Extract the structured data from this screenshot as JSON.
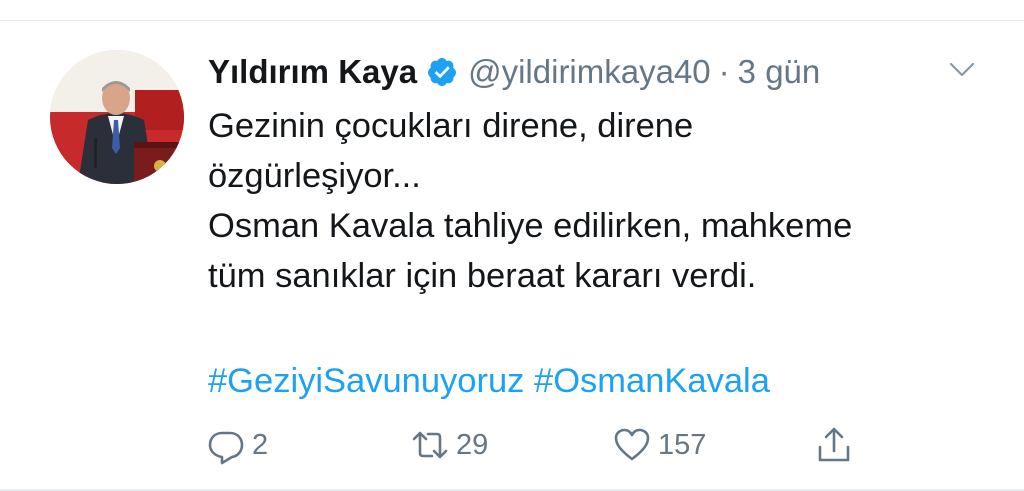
{
  "tweet": {
    "author_name": "Yıldırım Kaya",
    "handle": "@yildirimkaya40",
    "separator": "·",
    "time": "3 gün",
    "text_lines": [
      "Gezinin çocukları direne, direne",
      "özgürleşiyor...",
      "Osman Kavala tahliye edilirken, mahkeme",
      "tüm sanıklar için beraat kararı verdi."
    ],
    "hashtags": [
      "#GeziyiSavunuyoruz",
      "#OsmanKavala"
    ]
  },
  "actions": {
    "reply_count": "2",
    "retweet_count": "29",
    "like_count": "157"
  },
  "icons": {
    "verified": "verified-badge-icon",
    "more": "chevron-down-icon",
    "reply": "reply-icon",
    "retweet": "retweet-icon",
    "like": "heart-icon",
    "share": "share-icon"
  },
  "colors": {
    "accent": "#1da1f2",
    "secondary_text": "#657786",
    "primary_text": "#14171a"
  }
}
